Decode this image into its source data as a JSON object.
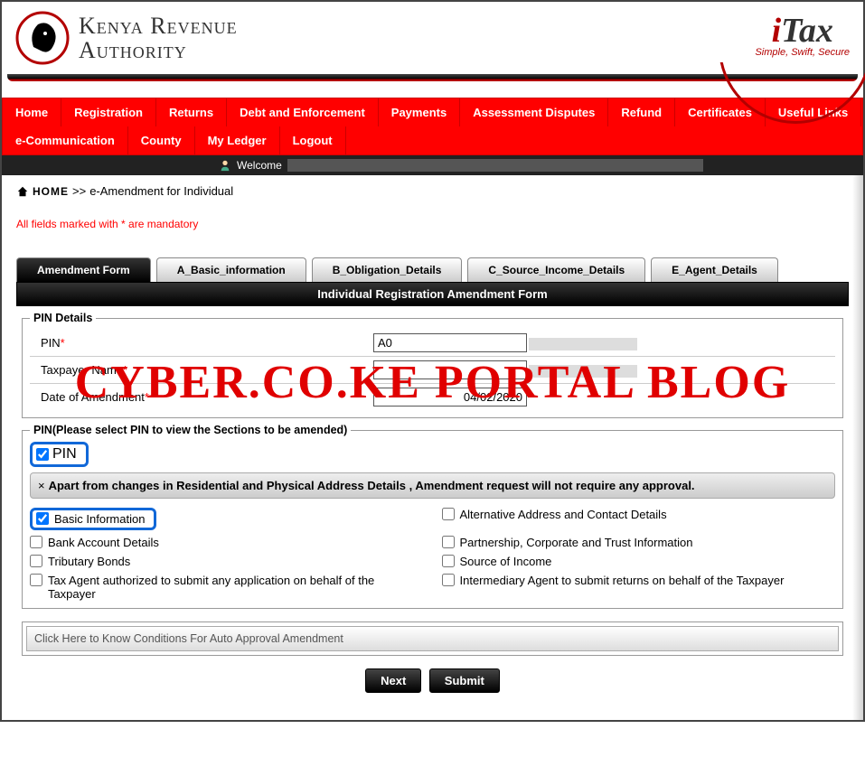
{
  "header": {
    "org_line1": "Kenya Revenue",
    "org_line2": "Authority",
    "itax_i": "i",
    "itax_tax": "Tax",
    "tagline": "Simple, Swift, Secure"
  },
  "nav": {
    "row1": [
      "Home",
      "Registration",
      "Returns",
      "Debt and Enforcement",
      "Payments",
      "Assessment Disputes",
      "Refund",
      "Certificates",
      "Useful Links"
    ],
    "row2": [
      "e-Communication",
      "County",
      "My Ledger",
      "Logout"
    ]
  },
  "welcome_label": "Welcome",
  "breadcrumb": {
    "home": "HOME",
    "sep": ">>",
    "page": "e-Amendment for Individual"
  },
  "mandatory_note": "All fields marked with * are mandatory",
  "tabs": {
    "t0": "Amendment Form",
    "t1": "A_Basic_information",
    "t2": "B_Obligation_Details",
    "t3": "C_Source_Income_Details",
    "t4": "E_Agent_Details"
  },
  "form_title": "Individual Registration Amendment Form",
  "pin_details": {
    "legend": "PIN Details",
    "pin_label": "PIN",
    "pin_value": "A0",
    "taxpayer_label": "Taxpayer Name",
    "taxpayer_value": "",
    "date_label": "Date of Amendment",
    "date_value": "04/02/2020"
  },
  "pin_select": {
    "legend": "PIN(Please select PIN to view the Sections to be amended)",
    "pin_cb": "PIN",
    "note": "Apart from changes in Residential and Physical Address Details , Amendment request will not require any approval."
  },
  "sections": {
    "basic": "Basic Information",
    "alt": "Alternative Address and Contact Details",
    "bank": "Bank Account Details",
    "partner": "Partnership, Corporate and Trust Information",
    "trib": "Tributary Bonds",
    "source": "Source of Income",
    "taxagent": "Tax Agent authorized to submit any application on behalf of the Taxpayer",
    "interm": "Intermediary Agent to submit returns on behalf of the Taxpayer"
  },
  "conditions_text": "Click Here to Know Conditions For Auto Approval Amendment",
  "buttons": {
    "next": "Next",
    "submit": "Submit"
  },
  "watermark": "CYBER.CO.KE PORTAL BLOG"
}
